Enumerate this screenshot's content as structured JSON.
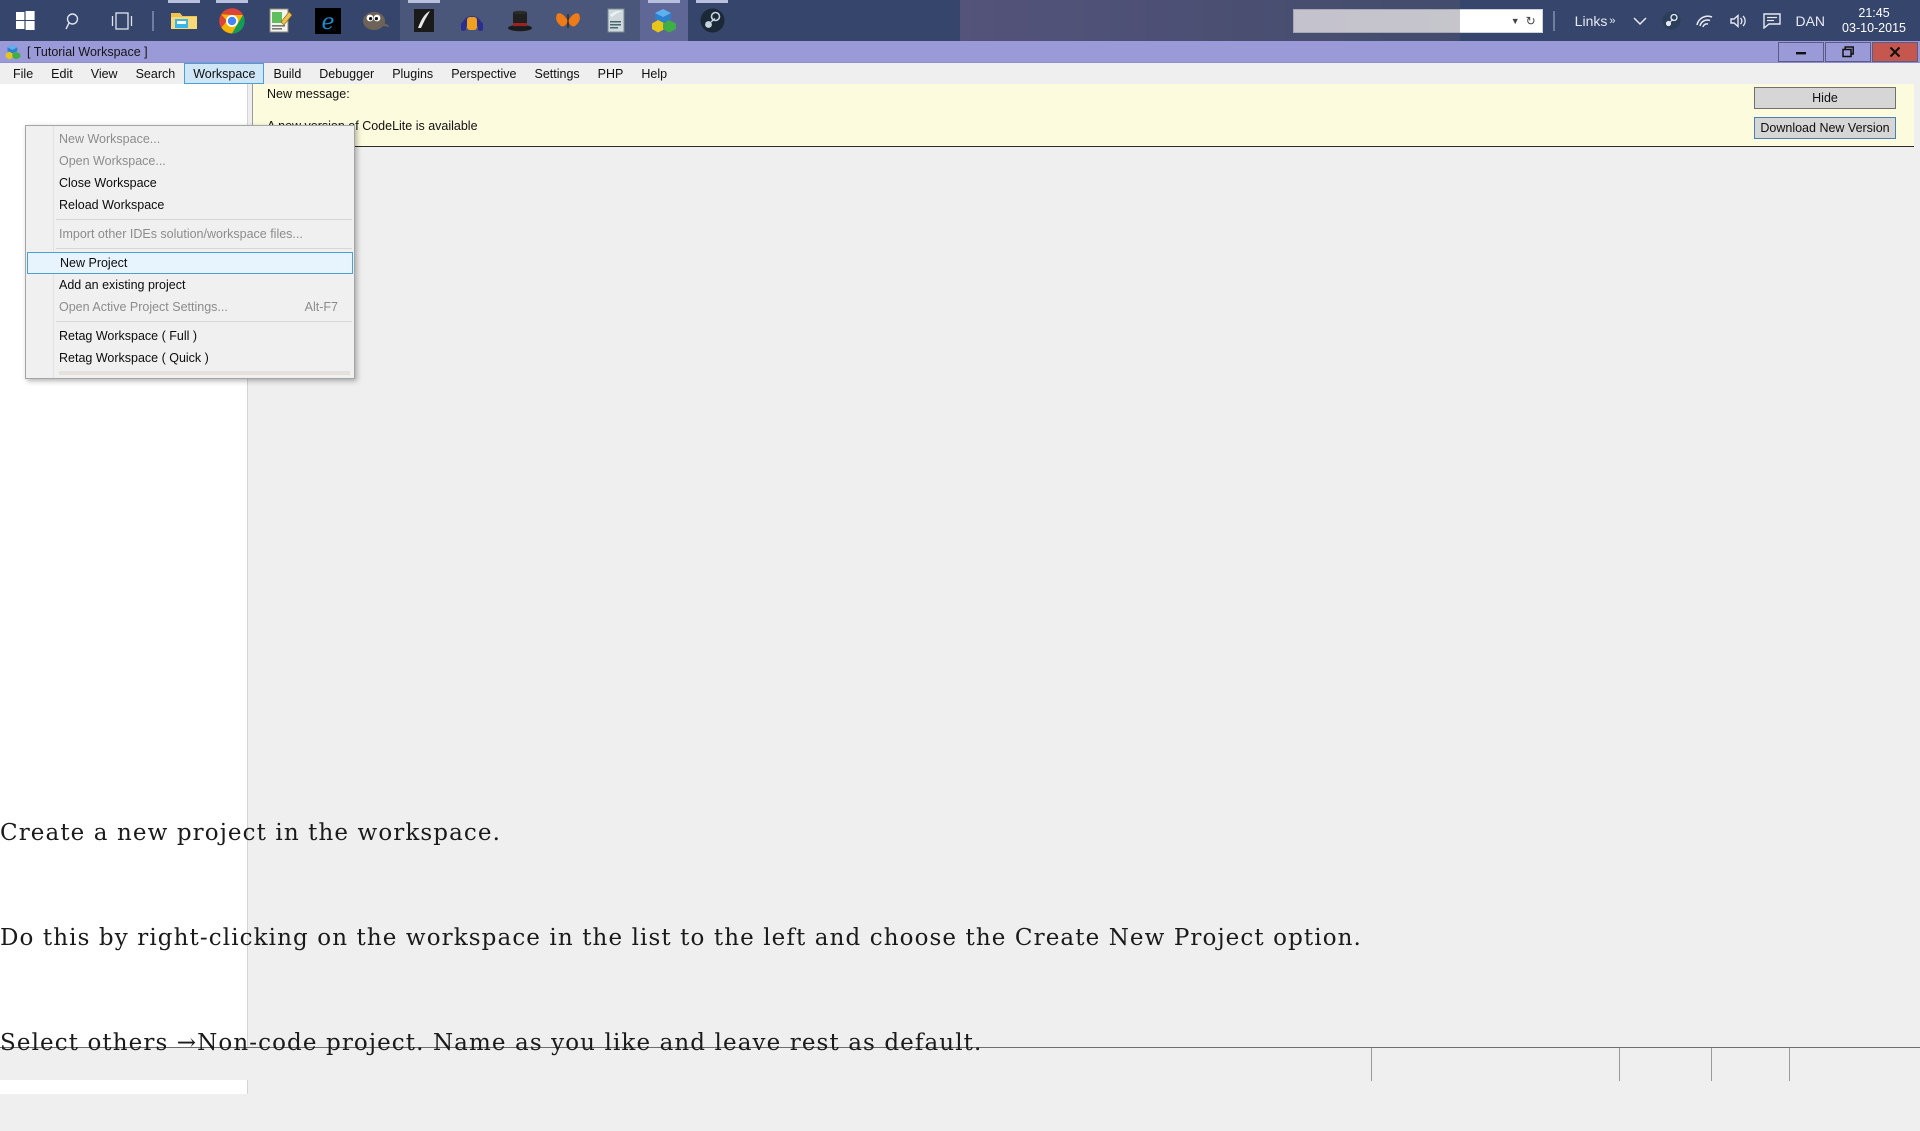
{
  "taskbar": {
    "start_icon": "windows-start-icon",
    "search_icon": "search-icon",
    "taskview_icon": "task-view-icon",
    "pinned": [
      {
        "name": "file-explorer-icon",
        "label": "File Explorer",
        "running": true
      },
      {
        "name": "google-chrome-icon",
        "label": "Google Chrome",
        "running": true
      },
      {
        "name": "notepadpp-icon",
        "label": "Notepad++",
        "running": false
      },
      {
        "name": "microsoft-edge-icon",
        "label": "Microsoft Edge",
        "running": false
      },
      {
        "name": "gimp-icon",
        "label": "GIMP",
        "running": false
      },
      {
        "name": "imagemagick-icon",
        "label": "ImageMagick",
        "running": true
      },
      {
        "name": "audacity-icon",
        "label": "Audacity",
        "running": false
      },
      {
        "name": "tophat-icon",
        "label": "MiKTeX",
        "running": false
      },
      {
        "name": "butterfly-icon",
        "label": "Inkscape",
        "running": false
      },
      {
        "name": "document-icon",
        "label": "Document",
        "running": false
      },
      {
        "name": "codelite-icon",
        "label": "CodeLite",
        "running": true
      },
      {
        "name": "steam-icon",
        "label": "Steam",
        "running": true
      }
    ],
    "tray": {
      "links_label": "Links",
      "links_overflow": "»",
      "chevron": "⌄",
      "steam_icon": "steam-tray-icon",
      "wifi_icon": "wifi-icon",
      "volume_icon": "volume-icon",
      "action_center_icon": "action-center-icon",
      "user_label": "DAN",
      "time": "21:45",
      "date": "03-10-2015",
      "search_box_value": ""
    }
  },
  "window": {
    "title": "[ Tutorial Workspace ]",
    "app_icon": "codelite-icon",
    "minimize_label": "–",
    "restore_label": "❐",
    "close_label": "✕"
  },
  "menubar": {
    "items": [
      {
        "label": "File",
        "open": false
      },
      {
        "label": "Edit",
        "open": false
      },
      {
        "label": "View",
        "open": false
      },
      {
        "label": "Search",
        "open": false
      },
      {
        "label": "Workspace",
        "open": true
      },
      {
        "label": "Build",
        "open": false
      },
      {
        "label": "Debugger",
        "open": false
      },
      {
        "label": "Plugins",
        "open": false
      },
      {
        "label": "Perspective",
        "open": false
      },
      {
        "label": "Settings",
        "open": false
      },
      {
        "label": "PHP",
        "open": false
      },
      {
        "label": "Help",
        "open": false
      }
    ]
  },
  "workspace_menu": {
    "items": [
      {
        "label": "New Workspace...",
        "shortcut": "",
        "disabled": true,
        "highlighted": false,
        "separator_after": false
      },
      {
        "label": "Open Workspace...",
        "shortcut": "",
        "disabled": true,
        "highlighted": false,
        "separator_after": false
      },
      {
        "label": "Close Workspace",
        "shortcut": "",
        "disabled": false,
        "highlighted": false,
        "separator_after": false
      },
      {
        "label": "Reload Workspace",
        "shortcut": "",
        "disabled": false,
        "highlighted": false,
        "separator_after": true
      },
      {
        "label": "Import other IDEs solution/workspace files...",
        "shortcut": "",
        "disabled": true,
        "highlighted": false,
        "separator_after": true
      },
      {
        "label": "New Project",
        "shortcut": "",
        "disabled": false,
        "highlighted": true,
        "separator_after": false
      },
      {
        "label": "Add an existing project",
        "shortcut": "",
        "disabled": false,
        "highlighted": false,
        "separator_after": false
      },
      {
        "label": "Open Active Project Settings...",
        "shortcut": "Alt-F7",
        "disabled": true,
        "highlighted": false,
        "separator_after": true
      },
      {
        "label": "Retag Workspace ( Full )",
        "shortcut": "",
        "disabled": false,
        "highlighted": false,
        "separator_after": false
      },
      {
        "label": "Retag Workspace ( Quick )",
        "shortcut": "",
        "disabled": false,
        "highlighted": false,
        "separator_after": false
      }
    ]
  },
  "notification": {
    "line1": "New message:",
    "line2": "A new version of CodeLite is available",
    "hide_label": "Hide",
    "download_label": "Download New Version"
  },
  "tutorial": {
    "line1": "Create a new project in the workspace.",
    "line2": "Do this by right-clicking on the workspace in the list to the left and choose the Create New Project option.",
    "line3": "Select others →Non-code project. Name as you like and leave rest as default."
  },
  "statusbar": {
    "cells": [
      "",
      "",
      "",
      "",
      ""
    ]
  },
  "colors": {
    "taskbar_bg": "#36456b",
    "titlebar_bg": "#9a9ad8",
    "close_btn": "#c5574f",
    "menu_highlight": "#cfe6f7",
    "menu_highlight_border": "#4a9fd4",
    "notification_bg": "#fdfbdd",
    "panel_bg": "#efefef"
  }
}
